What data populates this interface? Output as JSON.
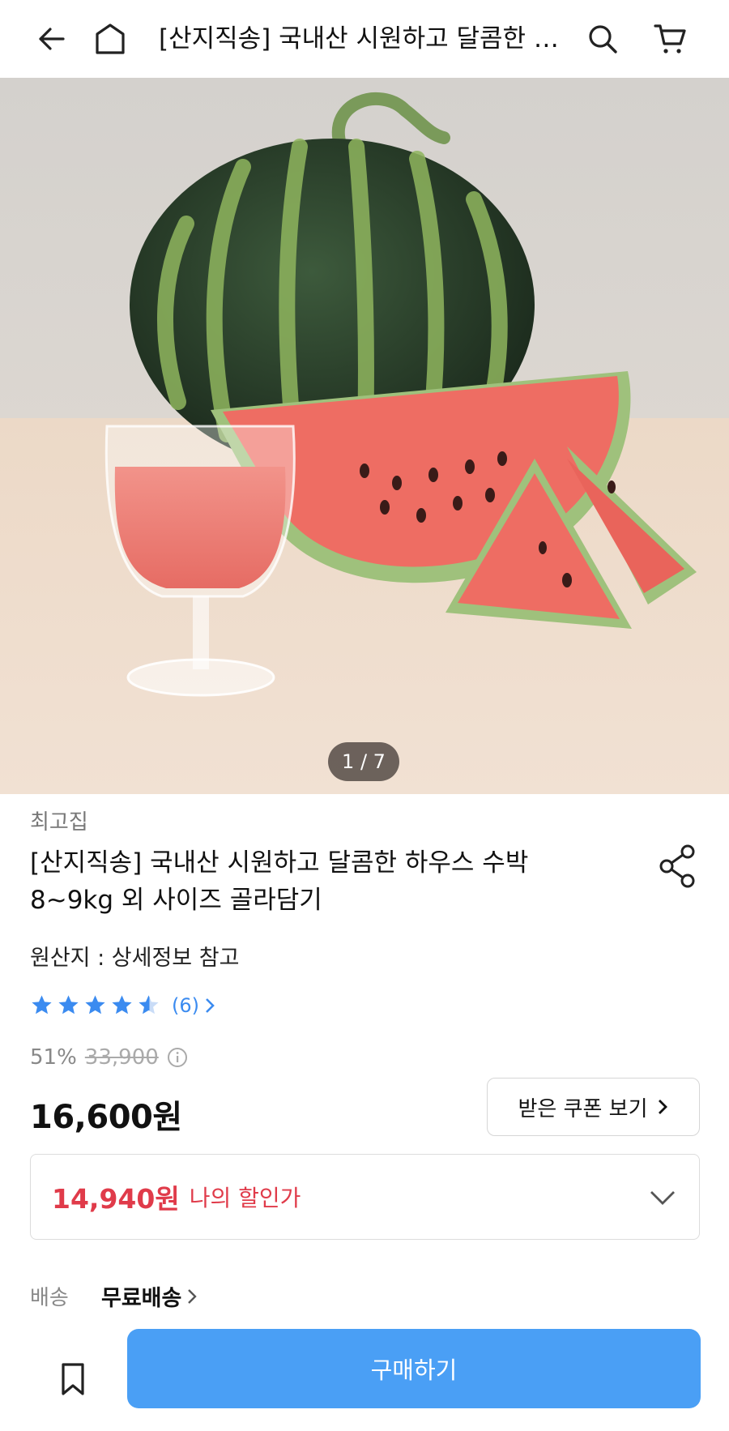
{
  "header": {
    "title": "[산지직송] 국내산 시원하고 달콤한 하우스 수박 8~9kg 외 사이즈 골라담기",
    "back_icon": "arrow-left-icon",
    "home_icon": "home-icon",
    "search_icon": "search-icon",
    "cart_icon": "cart-icon"
  },
  "gallery": {
    "pager": "1 / 7"
  },
  "product": {
    "seller": "최고집",
    "title": "[산지직송] 국내산 시원하고 달콤한 하우스 수박 8~9kg 외 사이즈 골라담기",
    "origin": "원산지 : 상세정보 참고",
    "rating": 4.5,
    "review_count": "(6)",
    "discount_rate": "51%",
    "original_price": "33,900",
    "price": "16,600원",
    "coupon_button": "받은 쿠폰 보기",
    "my_deal_price": "14,940원",
    "my_deal_label": "나의 할인가",
    "shipping_label": "배송",
    "shipping_value": "무료배송"
  },
  "bottom_bar": {
    "buy_label": "구매하기",
    "bookmark_icon": "bookmark-icon"
  },
  "colors": {
    "accent_blue": "#4a9ff5",
    "star_blue": "#3b8bf0",
    "deal_red": "#e03b4a"
  }
}
